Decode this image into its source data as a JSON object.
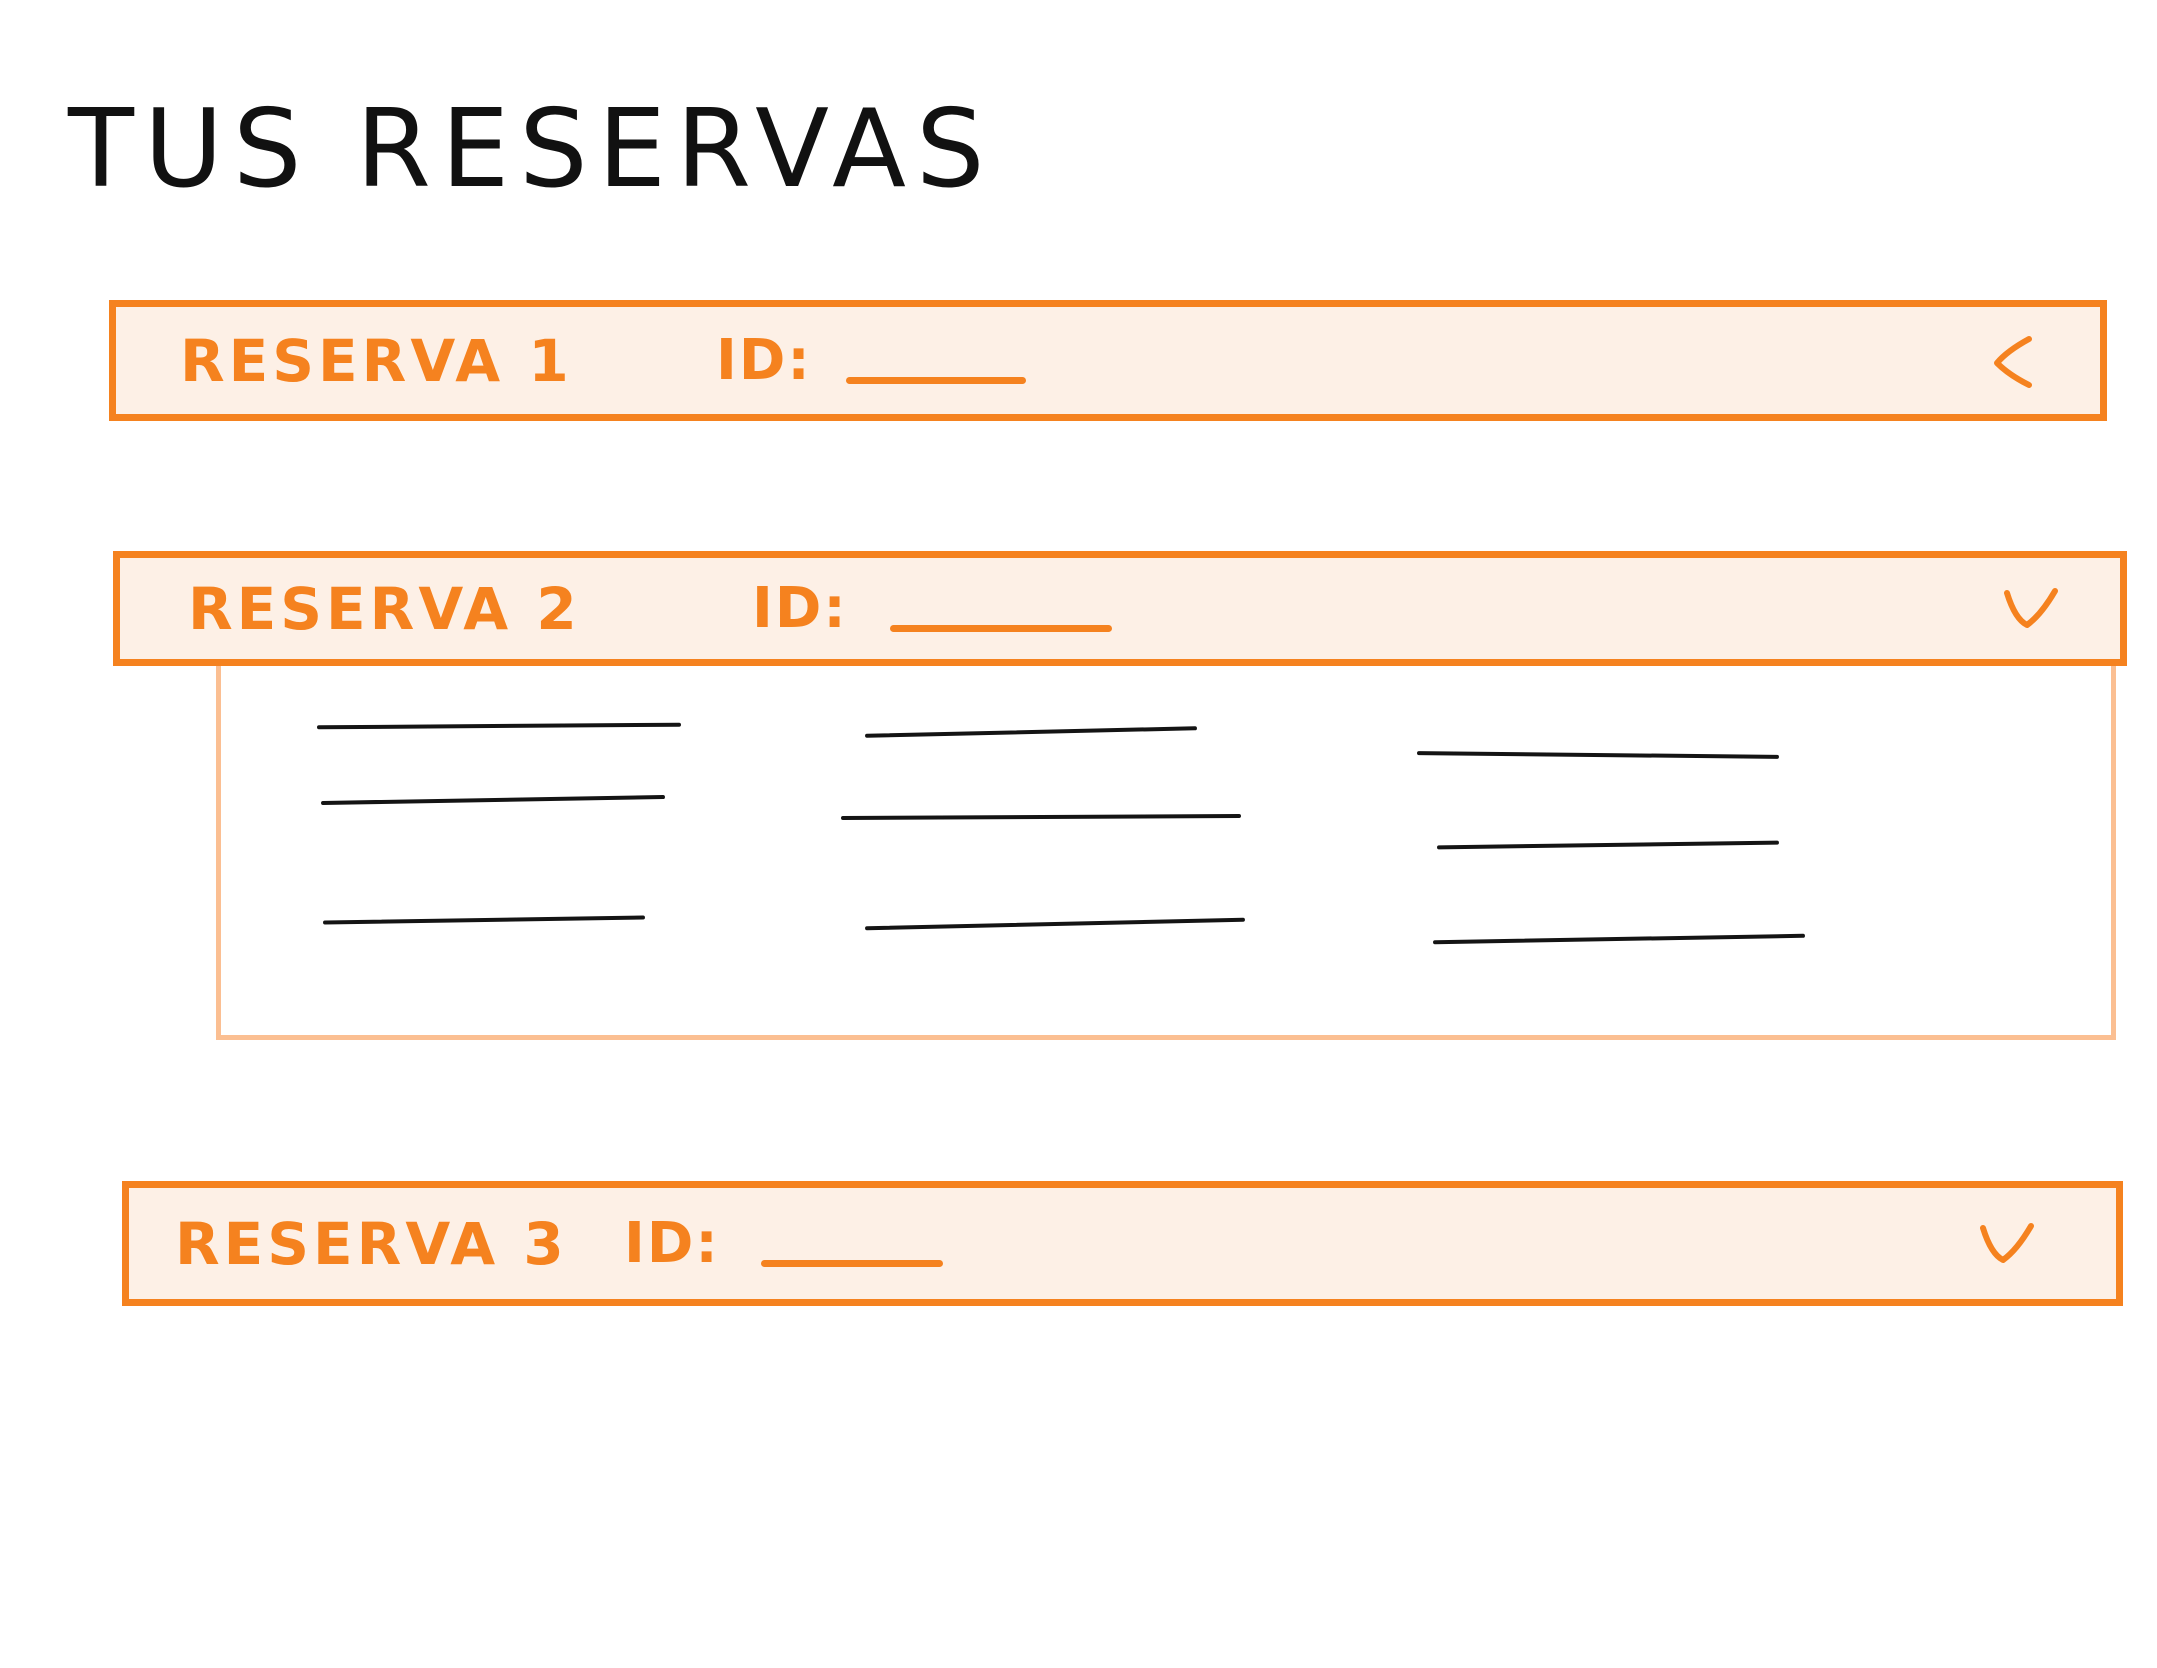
{
  "page": {
    "title": "TUS RESERVAS"
  },
  "colors": {
    "accent": "#f5821f",
    "header_fill": "#fdf0e6",
    "panel_border": "#fbbf92",
    "ink": "#111111"
  },
  "reservations": [
    {
      "label": "RESERVA 1",
      "id_label": "ID:",
      "state": "collapsed",
      "indicator_icon": "chevron-left-icon"
    },
    {
      "label": "RESERVA 2",
      "id_label": "ID:",
      "state": "expanded",
      "indicator_icon": "chevron-down-icon"
    },
    {
      "label": "RESERVA 3",
      "id_label": "ID:",
      "state": "collapsed",
      "indicator_icon": "chevron-down-icon"
    }
  ]
}
